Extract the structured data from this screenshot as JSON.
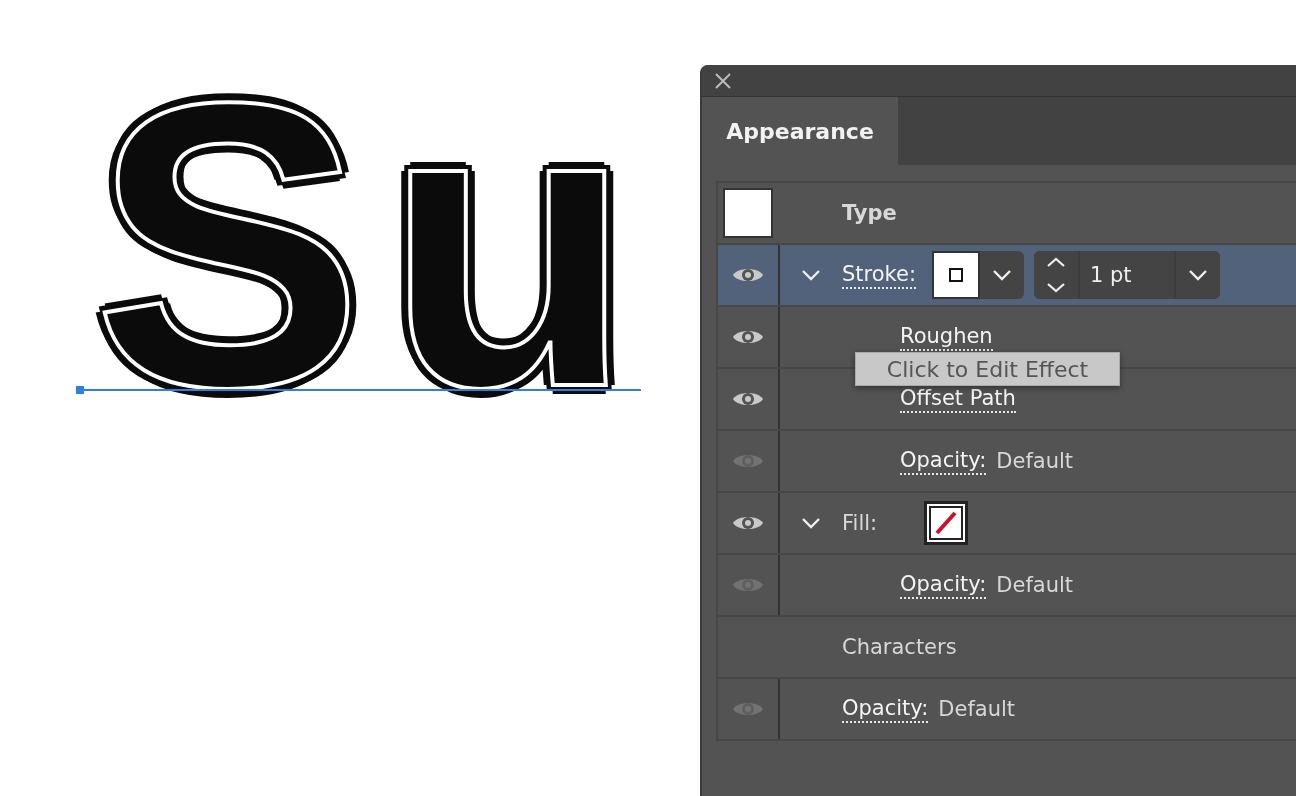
{
  "canvas": {
    "artwork_text": "Su"
  },
  "panel": {
    "tab": {
      "label": "Appearance",
      "selected": true
    },
    "target": {
      "label": "Type"
    },
    "rows": [
      {
        "kind": "stroke",
        "label": "Stroke:",
        "visible": true,
        "selected": true,
        "expanded": true,
        "weight": "1 pt",
        "children": [
          {
            "kind": "effect",
            "label": "Roughen",
            "visible": true,
            "selected": false
          },
          {
            "kind": "effect",
            "label": "Offset Path",
            "visible": true,
            "selected": false
          },
          {
            "kind": "opacity",
            "label": "Opacity:",
            "value": "Default",
            "visible": false,
            "selected": false
          }
        ]
      },
      {
        "kind": "fill",
        "label": "Fill:",
        "visible": true,
        "selected": false,
        "expanded": true,
        "children": [
          {
            "kind": "opacity",
            "label": "Opacity:",
            "value": "Default",
            "visible": false,
            "selected": false
          }
        ]
      },
      {
        "kind": "heading",
        "label": "Characters",
        "selected": false
      },
      {
        "kind": "opacity",
        "label": "Opacity:",
        "value": "Default",
        "visible": false,
        "selected": false
      }
    ],
    "tooltip": {
      "text": "Click to Edit Effect"
    }
  }
}
